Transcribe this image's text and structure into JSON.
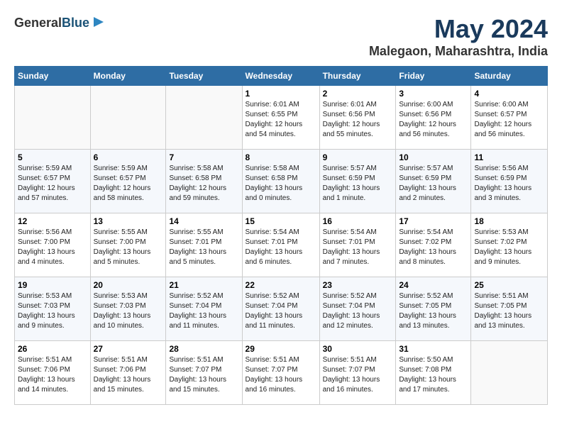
{
  "logo": {
    "general": "General",
    "blue": "Blue"
  },
  "title": "May 2024",
  "subtitle": "Malegaon, Maharashtra, India",
  "days_header": [
    "Sunday",
    "Monday",
    "Tuesday",
    "Wednesday",
    "Thursday",
    "Friday",
    "Saturday"
  ],
  "weeks": [
    [
      {
        "day": "",
        "info": ""
      },
      {
        "day": "",
        "info": ""
      },
      {
        "day": "",
        "info": ""
      },
      {
        "day": "1",
        "info": "Sunrise: 6:01 AM\nSunset: 6:55 PM\nDaylight: 12 hours\nand 54 minutes."
      },
      {
        "day": "2",
        "info": "Sunrise: 6:01 AM\nSunset: 6:56 PM\nDaylight: 12 hours\nand 55 minutes."
      },
      {
        "day": "3",
        "info": "Sunrise: 6:00 AM\nSunset: 6:56 PM\nDaylight: 12 hours\nand 56 minutes."
      },
      {
        "day": "4",
        "info": "Sunrise: 6:00 AM\nSunset: 6:57 PM\nDaylight: 12 hours\nand 56 minutes."
      }
    ],
    [
      {
        "day": "5",
        "info": "Sunrise: 5:59 AM\nSunset: 6:57 PM\nDaylight: 12 hours\nand 57 minutes."
      },
      {
        "day": "6",
        "info": "Sunrise: 5:59 AM\nSunset: 6:57 PM\nDaylight: 12 hours\nand 58 minutes."
      },
      {
        "day": "7",
        "info": "Sunrise: 5:58 AM\nSunset: 6:58 PM\nDaylight: 12 hours\nand 59 minutes."
      },
      {
        "day": "8",
        "info": "Sunrise: 5:58 AM\nSunset: 6:58 PM\nDaylight: 13 hours\nand 0 minutes."
      },
      {
        "day": "9",
        "info": "Sunrise: 5:57 AM\nSunset: 6:59 PM\nDaylight: 13 hours\nand 1 minute."
      },
      {
        "day": "10",
        "info": "Sunrise: 5:57 AM\nSunset: 6:59 PM\nDaylight: 13 hours\nand 2 minutes."
      },
      {
        "day": "11",
        "info": "Sunrise: 5:56 AM\nSunset: 6:59 PM\nDaylight: 13 hours\nand 3 minutes."
      }
    ],
    [
      {
        "day": "12",
        "info": "Sunrise: 5:56 AM\nSunset: 7:00 PM\nDaylight: 13 hours\nand 4 minutes."
      },
      {
        "day": "13",
        "info": "Sunrise: 5:55 AM\nSunset: 7:00 PM\nDaylight: 13 hours\nand 5 minutes."
      },
      {
        "day": "14",
        "info": "Sunrise: 5:55 AM\nSunset: 7:01 PM\nDaylight: 13 hours\nand 5 minutes."
      },
      {
        "day": "15",
        "info": "Sunrise: 5:54 AM\nSunset: 7:01 PM\nDaylight: 13 hours\nand 6 minutes."
      },
      {
        "day": "16",
        "info": "Sunrise: 5:54 AM\nSunset: 7:01 PM\nDaylight: 13 hours\nand 7 minutes."
      },
      {
        "day": "17",
        "info": "Sunrise: 5:54 AM\nSunset: 7:02 PM\nDaylight: 13 hours\nand 8 minutes."
      },
      {
        "day": "18",
        "info": "Sunrise: 5:53 AM\nSunset: 7:02 PM\nDaylight: 13 hours\nand 9 minutes."
      }
    ],
    [
      {
        "day": "19",
        "info": "Sunrise: 5:53 AM\nSunset: 7:03 PM\nDaylight: 13 hours\nand 9 minutes."
      },
      {
        "day": "20",
        "info": "Sunrise: 5:53 AM\nSunset: 7:03 PM\nDaylight: 13 hours\nand 10 minutes."
      },
      {
        "day": "21",
        "info": "Sunrise: 5:52 AM\nSunset: 7:04 PM\nDaylight: 13 hours\nand 11 minutes."
      },
      {
        "day": "22",
        "info": "Sunrise: 5:52 AM\nSunset: 7:04 PM\nDaylight: 13 hours\nand 11 minutes."
      },
      {
        "day": "23",
        "info": "Sunrise: 5:52 AM\nSunset: 7:04 PM\nDaylight: 13 hours\nand 12 minutes."
      },
      {
        "day": "24",
        "info": "Sunrise: 5:52 AM\nSunset: 7:05 PM\nDaylight: 13 hours\nand 13 minutes."
      },
      {
        "day": "25",
        "info": "Sunrise: 5:51 AM\nSunset: 7:05 PM\nDaylight: 13 hours\nand 13 minutes."
      }
    ],
    [
      {
        "day": "26",
        "info": "Sunrise: 5:51 AM\nSunset: 7:06 PM\nDaylight: 13 hours\nand 14 minutes."
      },
      {
        "day": "27",
        "info": "Sunrise: 5:51 AM\nSunset: 7:06 PM\nDaylight: 13 hours\nand 15 minutes."
      },
      {
        "day": "28",
        "info": "Sunrise: 5:51 AM\nSunset: 7:07 PM\nDaylight: 13 hours\nand 15 minutes."
      },
      {
        "day": "29",
        "info": "Sunrise: 5:51 AM\nSunset: 7:07 PM\nDaylight: 13 hours\nand 16 minutes."
      },
      {
        "day": "30",
        "info": "Sunrise: 5:51 AM\nSunset: 7:07 PM\nDaylight: 13 hours\nand 16 minutes."
      },
      {
        "day": "31",
        "info": "Sunrise: 5:50 AM\nSunset: 7:08 PM\nDaylight: 13 hours\nand 17 minutes."
      },
      {
        "day": "",
        "info": ""
      }
    ]
  ]
}
